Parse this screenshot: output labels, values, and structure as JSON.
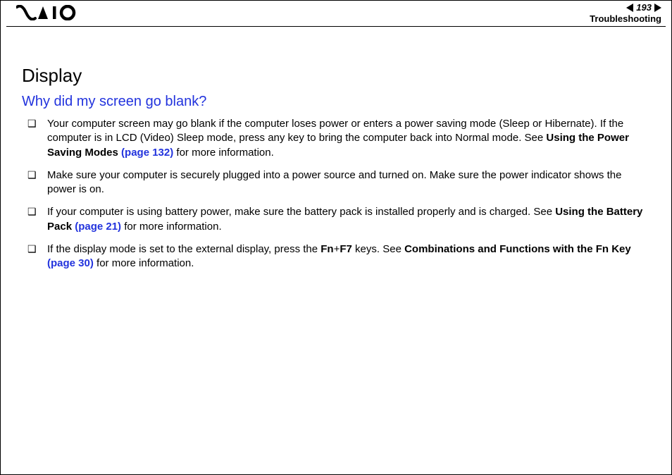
{
  "header": {
    "page_number": "193",
    "section": "Troubleshooting"
  },
  "content": {
    "title": "Display",
    "question": "Why did my screen go blank?",
    "items": [
      {
        "pre": "Your computer screen may go blank if the computer loses power or enters a power saving mode (Sleep or Hibernate). If the computer is in LCD (Video) Sleep mode, press any key to bring the computer back into Normal mode. See ",
        "bold1": "Using the Power Saving Modes ",
        "link1": "(page 132)",
        "post": " for more information."
      },
      {
        "pre": "Make sure your computer is securely plugged into a power source and turned on. Make sure the power indicator shows the power is on."
      },
      {
        "pre": "If your computer is using battery power, make sure the battery pack is installed properly and is charged. See ",
        "bold1": "Using the Battery Pack ",
        "link1": "(page 21)",
        "post": " for more information."
      },
      {
        "pre": "If the display mode is set to the external display, press the ",
        "bold1": "Fn",
        "mid1": "+",
        "bold2": "F7",
        "mid2": " keys. See ",
        "bold3": "Combinations and Functions with the Fn Key ",
        "link1": "(page 30)",
        "post": " for more information."
      }
    ]
  }
}
